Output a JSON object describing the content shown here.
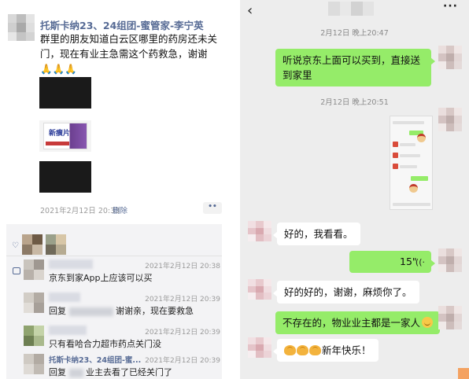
{
  "moments": {
    "author": "托斯卡纳23、24组团-蜜管家-李宁英",
    "text": "群里的朋友知道白云区哪里的药房还未关门，现在有业主急需这个药救急，谢谢🙏🙏🙏",
    "product_label": "新癀片",
    "timestamp": "2021年2月12日 20:33",
    "delete_label": "删除",
    "more_label": "••",
    "icons": {
      "like": "heart-icon",
      "comment": "comment-icon",
      "more": "more-dots-icon"
    },
    "comments": [
      {
        "author": "",
        "time": "2021年2月12日 20:38",
        "text": "京东到家App上应该可以买"
      },
      {
        "author": "",
        "time": "2021年2月12日 20:39",
        "reply_prefix": "回复",
        "text": "谢谢亲，现在要救急"
      },
      {
        "author": "",
        "time": "2021年2月12日 20:39",
        "text": "只有看哈合力超市药点关门没"
      },
      {
        "author": "托斯卡纳23、24组团-蜜...",
        "time": "2021年2月12日 20:39",
        "reply_prefix": "回复",
        "text": "业主去看了已经关门了"
      }
    ]
  },
  "chat": {
    "icons": {
      "back": "back-arrow-icon",
      "more": "more-options-icon",
      "voice": "voice-wave-icon"
    },
    "back_glyph": "‹",
    "more_glyph": "···",
    "timestamps": [
      "2月12日 晚上20:47",
      "2月12日 晚上20:51"
    ],
    "messages": [
      {
        "side": "me",
        "text": "听说京东上面可以买到，直接送到家里"
      },
      {
        "side": "me",
        "type": "image"
      },
      {
        "side": "other",
        "text": "好的，我看看。"
      },
      {
        "side": "me",
        "type": "voice",
        "text": "15\""
      },
      {
        "side": "other",
        "text": "好的好的，谢谢，麻烦你了。"
      },
      {
        "side": "me",
        "text": "不存在的，物业业主都是一家人"
      },
      {
        "side": "other",
        "text": "新年快乐！"
      }
    ],
    "colors": {
      "my_bubble": "#95ec69",
      "other_bubble": "#ffffff",
      "background": "#ededed",
      "link_blue": "#576b95"
    }
  }
}
